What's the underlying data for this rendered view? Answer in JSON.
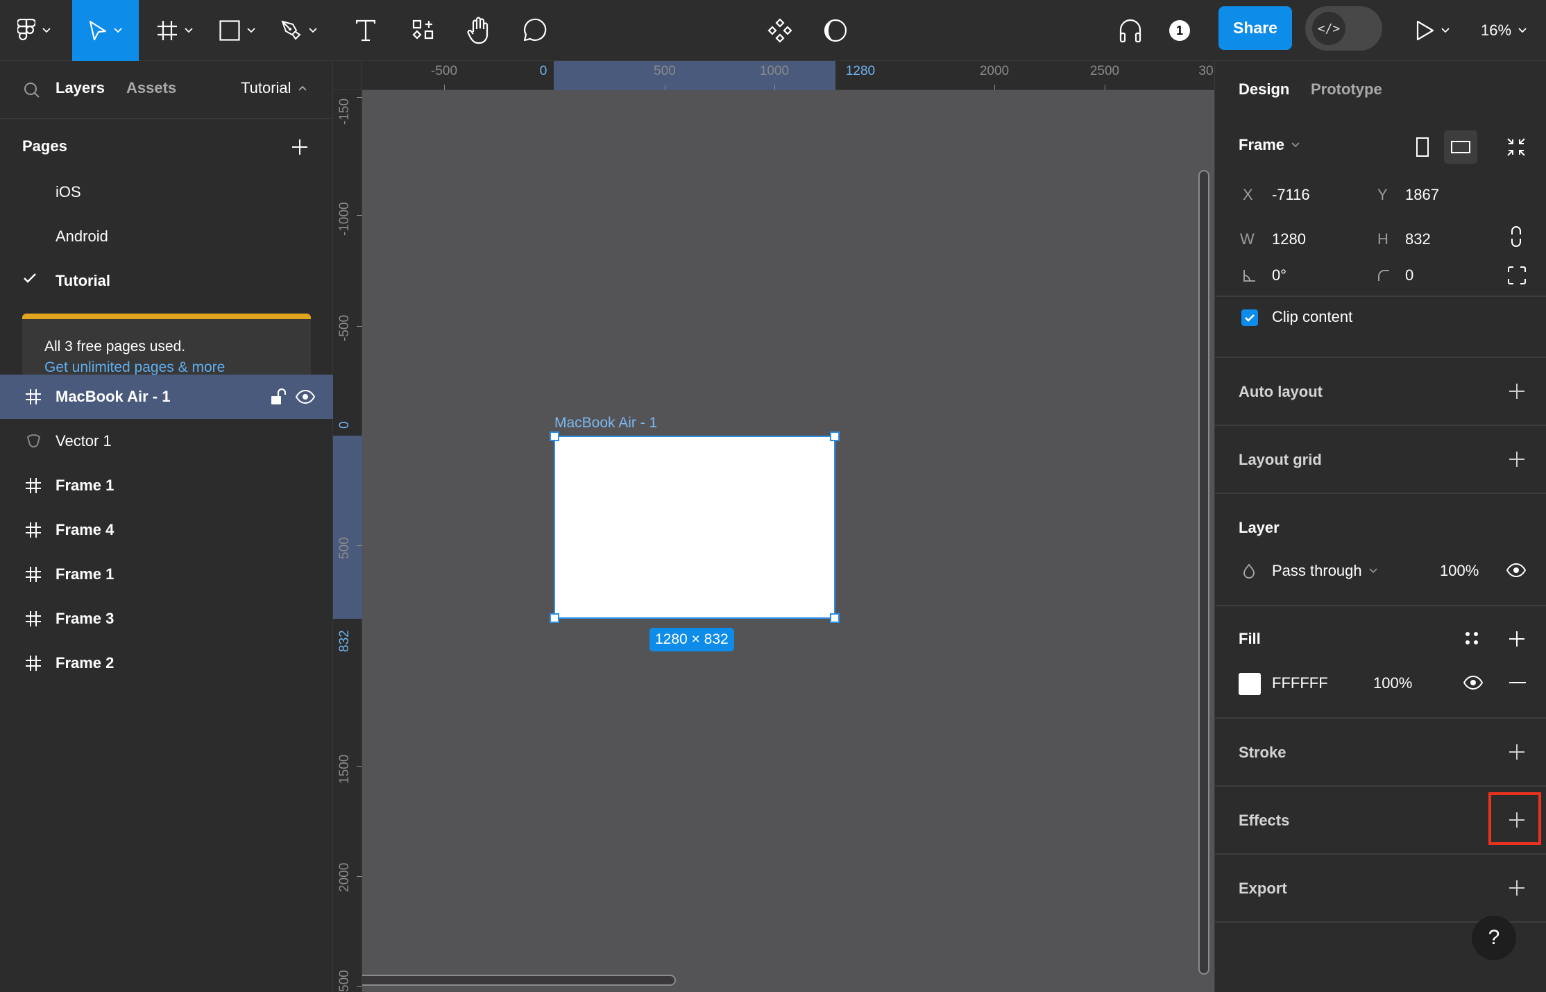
{
  "toolbar": {
    "tools": [
      {
        "name": "main-menu",
        "icon": "figma-logo-icon",
        "has_dropdown": true
      },
      {
        "name": "move",
        "icon": "move-cursor-icon",
        "has_dropdown": true,
        "active": true
      },
      {
        "name": "frame",
        "icon": "frame-hash-icon",
        "has_dropdown": true
      },
      {
        "name": "shape",
        "icon": "rectangle-icon",
        "has_dropdown": true
      },
      {
        "name": "pen",
        "icon": "pen-icon",
        "has_dropdown": true
      },
      {
        "name": "text",
        "icon": "text-icon",
        "has_dropdown": false
      },
      {
        "name": "resources",
        "icon": "resources-icon",
        "has_dropdown": false
      },
      {
        "name": "hand",
        "icon": "hand-icon",
        "has_dropdown": false
      },
      {
        "name": "comment",
        "icon": "comment-icon",
        "has_dropdown": false
      }
    ],
    "center_tools": [
      "components-icon",
      "contrast-icon"
    ],
    "share_label": "Share",
    "dev_mode_label": "</>",
    "zoom_level": "16%",
    "avatar_initial": "1",
    "accent_color": "#0d8ce9"
  },
  "left_panel": {
    "tabs": {
      "layers": "Layers",
      "assets": "Assets"
    },
    "page_selector": "Tutorial",
    "pages_header": "Pages",
    "pages": [
      {
        "label": "iOS",
        "current": false
      },
      {
        "label": "Android",
        "current": false
      },
      {
        "label": "Tutorial",
        "current": true
      }
    ],
    "upgrade_notice": {
      "text": "All 3 free pages used.",
      "link": "Get unlimited pages & more"
    },
    "layers": [
      {
        "label": "MacBook Air - 1",
        "type": "frame",
        "selected": true
      },
      {
        "label": "Vector 1",
        "type": "vector",
        "selected": false
      },
      {
        "label": "Frame 1",
        "type": "frame",
        "selected": false
      },
      {
        "label": "Frame 4",
        "type": "frame",
        "selected": false
      },
      {
        "label": "Frame 1",
        "type": "frame",
        "selected": false
      },
      {
        "label": "Frame 3",
        "type": "frame",
        "selected": false
      },
      {
        "label": "Frame 2",
        "type": "frame",
        "selected": false
      }
    ]
  },
  "rulers": {
    "top": [
      {
        "label": "-500",
        "highlight": false
      },
      {
        "label": "0",
        "highlight": true
      },
      {
        "label": "500",
        "highlight": false
      },
      {
        "label": "1000",
        "highlight": false
      },
      {
        "label": "1280",
        "highlight": true
      },
      {
        "label": "2000",
        "highlight": false
      },
      {
        "label": "2500",
        "highlight": false
      },
      {
        "label": "30",
        "highlight": false
      }
    ],
    "left": [
      {
        "label": "-150",
        "highlight": false
      },
      {
        "label": "-1000",
        "highlight": false
      },
      {
        "label": "-500",
        "highlight": false
      },
      {
        "label": "0",
        "highlight": true
      },
      {
        "label": "500",
        "highlight": false
      },
      {
        "label": "832",
        "highlight": true
      },
      {
        "label": "1500",
        "highlight": false
      },
      {
        "label": "2000",
        "highlight": false
      },
      {
        "label": "500",
        "highlight": false
      }
    ]
  },
  "canvas": {
    "frame_name": "MacBook Air - 1",
    "size_badge": "1280 × 832"
  },
  "right_panel": {
    "tabs": {
      "design": "Design",
      "prototype": "Prototype"
    },
    "frame": {
      "title": "Frame",
      "x_label": "X",
      "x": "-7116",
      "y_label": "Y",
      "y": "1867",
      "w_label": "W",
      "w": "1280",
      "h_label": "H",
      "h": "832",
      "rotation": "0°",
      "radius": "0",
      "clip_content_label": "Clip content",
      "clip_content": true
    },
    "auto_layout": "Auto layout",
    "layout_grid": "Layout grid",
    "layer": {
      "title": "Layer",
      "blend_mode": "Pass through",
      "opacity": "100%"
    },
    "fill": {
      "title": "Fill",
      "hex": "FFFFFF",
      "opacity": "100%"
    },
    "stroke": "Stroke",
    "effects": "Effects",
    "export": "Export",
    "help": "?"
  }
}
